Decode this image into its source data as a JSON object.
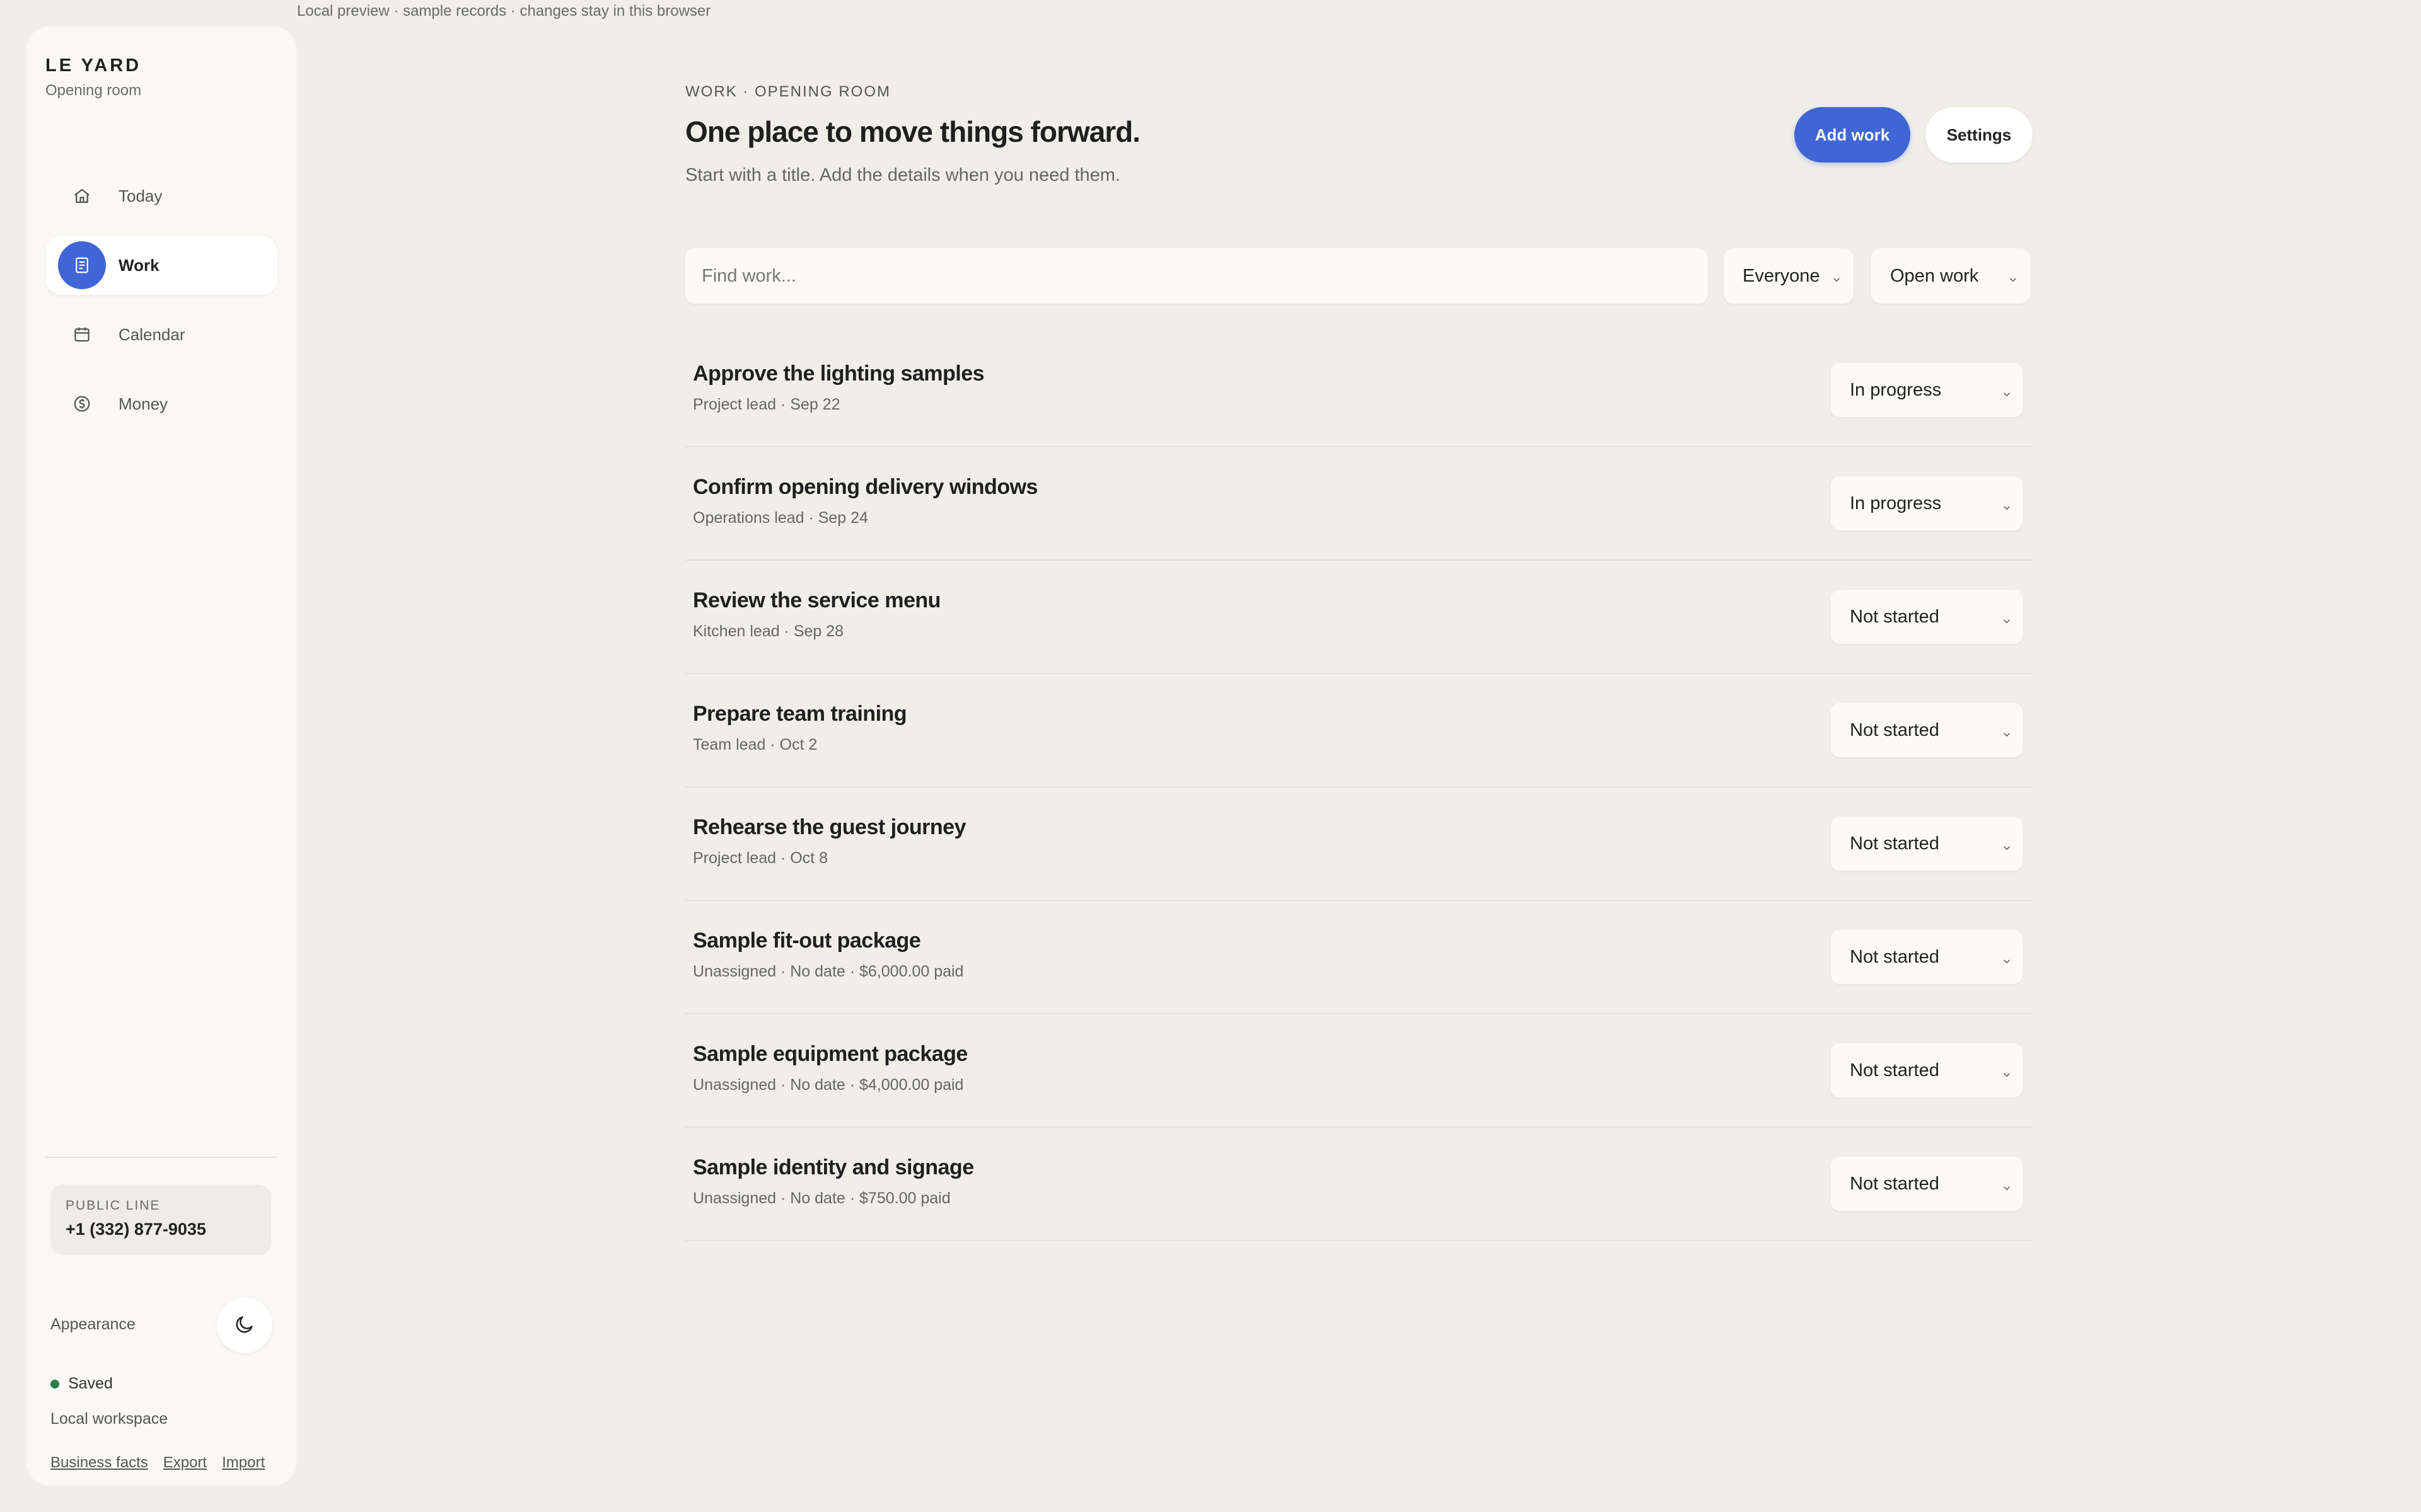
{
  "banner": "Local preview · sample records · changes stay in this browser",
  "sidebar": {
    "brand": "LE YARD",
    "subtitle": "Opening room",
    "items": [
      {
        "label": "Today",
        "icon": "home-icon",
        "active": false
      },
      {
        "label": "Work",
        "icon": "document-icon",
        "active": true
      },
      {
        "label": "Calendar",
        "icon": "calendar-icon",
        "active": false
      },
      {
        "label": "Money",
        "icon": "dollar-circle-icon",
        "active": false
      }
    ],
    "public_line_label": "PUBLIC LINE",
    "public_line_phone": "+1 (332) 877-9035",
    "appearance_label": "Appearance",
    "saved_label": "Saved",
    "workspace_label": "Local workspace",
    "links": [
      "Business facts",
      "Export",
      "Import"
    ]
  },
  "header": {
    "kicker": "WORK · OPENING ROOM",
    "title": "One place to move things forward.",
    "subtitle": "Start with a title. Add the details when you need them.",
    "add_label": "Add work",
    "settings_label": "Settings"
  },
  "filters": {
    "search_placeholder": "Find work...",
    "people": "Everyone",
    "scope": "Open work"
  },
  "work": [
    {
      "title": "Approve the lighting samples",
      "meta": "Project lead · Sep 22",
      "status": "In progress"
    },
    {
      "title": "Confirm opening delivery windows",
      "meta": "Operations lead · Sep 24",
      "status": "In progress"
    },
    {
      "title": "Review the service menu",
      "meta": "Kitchen lead · Sep 28",
      "status": "Not started"
    },
    {
      "title": "Prepare team training",
      "meta": "Team lead · Oct 2",
      "status": "Not started"
    },
    {
      "title": "Rehearse the guest journey",
      "meta": "Project lead · Oct 8",
      "status": "Not started"
    },
    {
      "title": "Sample fit-out package",
      "meta": "Unassigned · No date · $6,000.00 paid",
      "status": "Not started"
    },
    {
      "title": "Sample equipment package",
      "meta": "Unassigned · No date · $4,000.00 paid",
      "status": "Not started"
    },
    {
      "title": "Sample identity and signage",
      "meta": "Unassigned · No date · $750.00 paid",
      "status": "Not started"
    }
  ],
  "colors": {
    "accent": "#4066d5",
    "saved_dot": "#2f7a4f",
    "background": "#f0eee9"
  }
}
